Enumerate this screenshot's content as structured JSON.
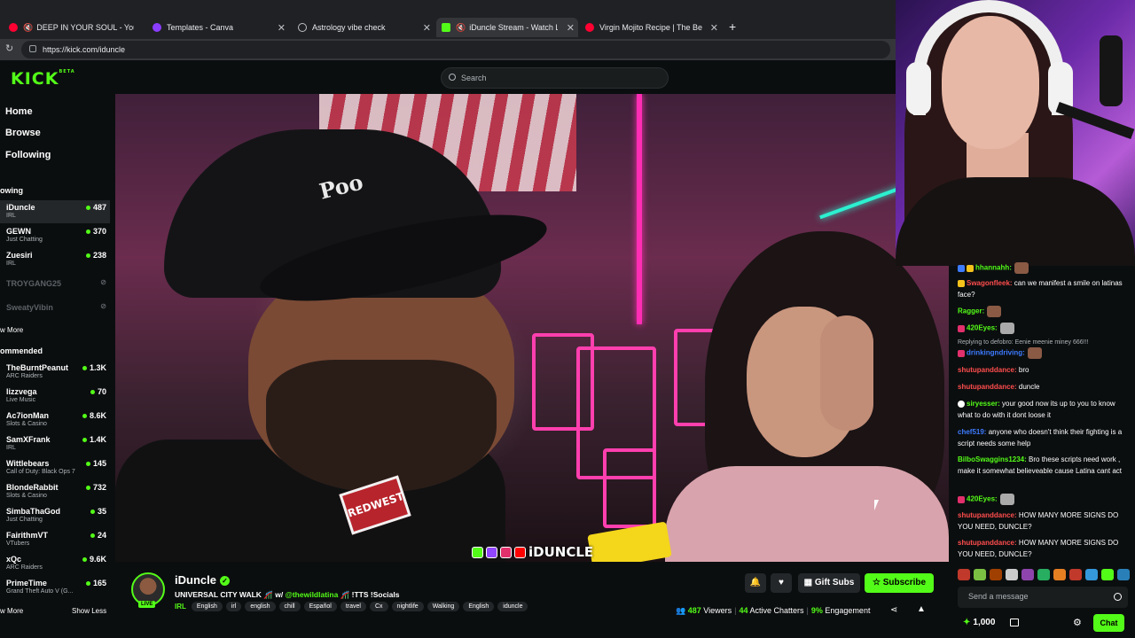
{
  "browser": {
    "tabs": [
      {
        "title": "DEEP IN YOUR SOUL - YouTube",
        "icon_color": "#ff0033",
        "muted": true
      },
      {
        "title": "Templates - Canva",
        "icon_color": "#8b3dff"
      },
      {
        "title": "Astrology vibe check",
        "icon_color": "#bdc1c6"
      },
      {
        "title": "iDuncle Stream - Watch Live",
        "icon_color": "#53fc18",
        "muted": true,
        "active": true
      },
      {
        "title": "Virgin Mojito Recipe | The Best C",
        "icon_color": "#ff0033"
      }
    ],
    "url": "https://kick.com/iduncle"
  },
  "header": {
    "logo": "KICK",
    "logo_badge": "BETA",
    "search_placeholder": "Search"
  },
  "sidebar": {
    "nav": [
      "Home",
      "Browse",
      "Following"
    ],
    "following_title": "owing",
    "following": [
      {
        "name": "iDuncle",
        "category": "IRL",
        "viewers": "487",
        "selected": true
      },
      {
        "name": "GEWN",
        "category": "Just Chatting",
        "viewers": "370"
      },
      {
        "name": "Zuesiri",
        "category": "IRL",
        "viewers": "238"
      },
      {
        "name": "TROYGANG25",
        "offline": true
      },
      {
        "name": "SweatyVibin",
        "offline": true
      }
    ],
    "show_more_following": "w More",
    "recommended_title": "ommended",
    "recommended": [
      {
        "name": "TheBurntPeanut",
        "category": "ARC Raiders",
        "viewers": "1.3K"
      },
      {
        "name": "lizzvega",
        "category": "Live Music",
        "viewers": "70"
      },
      {
        "name": "Ac7ionMan",
        "category": "Slots & Casino",
        "viewers": "8.6K"
      },
      {
        "name": "SamXFrank",
        "category": "IRL",
        "viewers": "1.4K"
      },
      {
        "name": "Wittlebears",
        "category": "Call of Duty: Black Ops 7",
        "viewers": "145"
      },
      {
        "name": "BlondeRabbit",
        "category": "Slots & Casino",
        "viewers": "732"
      },
      {
        "name": "SimbaThaGod",
        "category": "Just Chatting",
        "viewers": "35"
      },
      {
        "name": "FairithmVT",
        "category": "VTubers",
        "viewers": "24"
      },
      {
        "name": "xQc",
        "category": "ARC Raiders",
        "viewers": "9.6K"
      },
      {
        "name": "PrimeTime",
        "category": "Grand Theft Auto V (G...",
        "viewers": "165"
      }
    ],
    "show_more": "w More",
    "show_less": "Show Less"
  },
  "video": {
    "cap_text": "Poo",
    "patch_text": "REDWEST",
    "overlay_name": "iDUNCLE"
  },
  "stream": {
    "name": "iDuncle",
    "live_label": "LIVE",
    "title_prefix": "UNIVERSAL CITY WALK 🎢 w/ ",
    "title_mention": "@thewildlatina",
    "title_suffix": " 🎢 !TTS !Socials",
    "category": "IRL",
    "tags": [
      "English",
      "irl",
      "english",
      "chill",
      "Español",
      "travel",
      "Cx",
      "nightlife",
      "Walking",
      "English",
      "iduncle"
    ],
    "gift_label": "Gift Subs",
    "subscribe_label": "Subscribe",
    "viewers": "487",
    "viewers_label": "Viewers",
    "chatters": "44",
    "chatters_label": "Active Chatters",
    "engagement": "9%",
    "engagement_label": "Engagement"
  },
  "chat": {
    "messages": [
      {
        "user": "hhannahh:",
        "color": "#53fc18",
        "text": ""
      },
      {
        "user": "Swagonfleek:",
        "color": "#ff4d4d",
        "text": " can we manifest a smile on latinas face?"
      },
      {
        "user": "Ragger:",
        "color": "#53fc18",
        "text": ""
      },
      {
        "user": "420Eyes:",
        "color": "#53fc18",
        "text": ""
      },
      {
        "reply": "Replying to defobro: Eenie meenie miney 666!!!"
      },
      {
        "user": "drinkingndriving:",
        "color": "#3d7bff",
        "text": ""
      },
      {
        "user": "shutupanddance:",
        "color": "#ff4d4d",
        "text": " bro"
      },
      {
        "user": "shutupanddance:",
        "color": "#ff4d4d",
        "text": " duncle"
      },
      {
        "user": "siryesser:",
        "color": "#53fc18",
        "text": " your good now its up to you to know what to do with it dont loose it"
      },
      {
        "user": "chef519:",
        "color": "#3d7bff",
        "text": " anyone who doesn't think their fighting is a script needs some help"
      },
      {
        "user": "BilboSwaggins1234:",
        "color": "#53fc18",
        "text": " Bro these scripts need work , make it somewhat believeable cause Latina cant act"
      },
      {
        "user": "420Eyes:",
        "color": "#53fc18",
        "text": ""
      },
      {
        "user": "shutupanddance:",
        "color": "#ff4d4d",
        "text": " HOW MANY MORE SIGNS DO YOU NEED, DUNCLE?"
      },
      {
        "user": "shutupanddance:",
        "color": "#ff4d4d",
        "text": " HOW MANY MORE SIGNS DO YOU NEED, DUNCLE?"
      }
    ],
    "input_placeholder": "Send a message",
    "points": "1,000",
    "chat_button": "Chat"
  }
}
